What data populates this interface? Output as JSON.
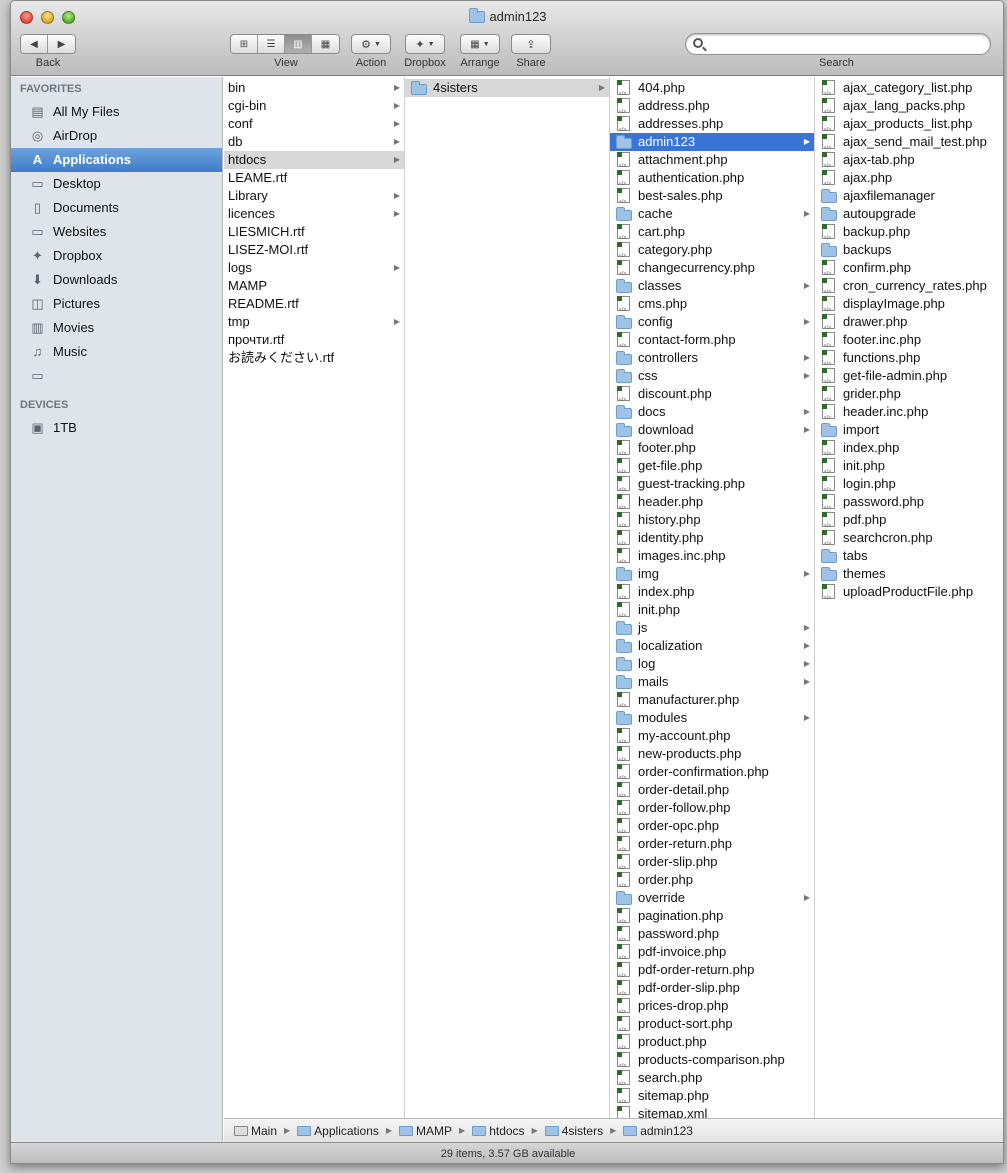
{
  "window": {
    "title": "admin123"
  },
  "toolbar": {
    "back_label": "Back",
    "view_label": "View",
    "action_label": "Action",
    "dropbox_label": "Dropbox",
    "arrange_label": "Arrange",
    "share_label": "Share",
    "search_label": "Search",
    "search_value": ""
  },
  "sidebar": {
    "favorites_heading": "FAVORITES",
    "devices_heading": "DEVICES",
    "favorites": [
      {
        "label": "All My Files",
        "icon": "all-files-icon",
        "glyph": "▤"
      },
      {
        "label": "AirDrop",
        "icon": "airdrop-icon",
        "glyph": "◎"
      },
      {
        "label": "Applications",
        "icon": "applications-icon",
        "glyph": "A"
      },
      {
        "label": "Desktop",
        "icon": "desktop-icon",
        "glyph": "▭"
      },
      {
        "label": "Documents",
        "icon": "documents-icon",
        "glyph": "▯"
      },
      {
        "label": "Websites",
        "icon": "websites-icon",
        "glyph": "▭"
      },
      {
        "label": "Dropbox",
        "icon": "dropbox-icon",
        "glyph": "✦"
      },
      {
        "label": "Downloads",
        "icon": "downloads-icon",
        "glyph": "⬇"
      },
      {
        "label": "Pictures",
        "icon": "pictures-icon",
        "glyph": "◫"
      },
      {
        "label": "Movies",
        "icon": "movies-icon",
        "glyph": "▥"
      },
      {
        "label": "Music",
        "icon": "music-icon",
        "glyph": "♫"
      }
    ],
    "selected_index": 2,
    "devices": [
      {
        "label": "1TB",
        "icon": "hard-disk-icon",
        "glyph": "▣"
      }
    ]
  },
  "columns": {
    "col1": [
      {
        "name": "bin",
        "folder": true
      },
      {
        "name": "cgi-bin",
        "folder": true
      },
      {
        "name": "conf",
        "folder": true
      },
      {
        "name": "db",
        "folder": true
      },
      {
        "name": "htdocs",
        "folder": true,
        "highlight": true
      },
      {
        "name": "LEAME.rtf",
        "folder": false
      },
      {
        "name": "Library",
        "folder": true
      },
      {
        "name": "licences",
        "folder": true
      },
      {
        "name": "LIESMICH.rtf",
        "folder": false
      },
      {
        "name": "LISEZ-MOI.rtf",
        "folder": false
      },
      {
        "name": "logs",
        "folder": true
      },
      {
        "name": "MAMP",
        "folder": false
      },
      {
        "name": "README.rtf",
        "folder": false
      },
      {
        "name": "tmp",
        "folder": true
      },
      {
        "name": "прочти.rtf",
        "folder": false
      },
      {
        "name": "お読みください.rtf",
        "folder": false
      }
    ],
    "col2": [
      {
        "name": "4sisters",
        "folder": true,
        "highlight": true
      }
    ],
    "col3": [
      {
        "name": "404.php",
        "folder": false
      },
      {
        "name": "address.php",
        "folder": false
      },
      {
        "name": "addresses.php",
        "folder": false
      },
      {
        "name": "admin123",
        "folder": true,
        "selected": true
      },
      {
        "name": "attachment.php",
        "folder": false
      },
      {
        "name": "authentication.php",
        "folder": false
      },
      {
        "name": "best-sales.php",
        "folder": false
      },
      {
        "name": "cache",
        "folder": true
      },
      {
        "name": "cart.php",
        "folder": false
      },
      {
        "name": "category.php",
        "folder": false
      },
      {
        "name": "changecurrency.php",
        "folder": false
      },
      {
        "name": "classes",
        "folder": true
      },
      {
        "name": "cms.php",
        "folder": false
      },
      {
        "name": "config",
        "folder": true
      },
      {
        "name": "contact-form.php",
        "folder": false
      },
      {
        "name": "controllers",
        "folder": true
      },
      {
        "name": "css",
        "folder": true
      },
      {
        "name": "discount.php",
        "folder": false
      },
      {
        "name": "docs",
        "folder": true
      },
      {
        "name": "download",
        "folder": true
      },
      {
        "name": "footer.php",
        "folder": false
      },
      {
        "name": "get-file.php",
        "folder": false
      },
      {
        "name": "guest-tracking.php",
        "folder": false
      },
      {
        "name": "header.php",
        "folder": false
      },
      {
        "name": "history.php",
        "folder": false
      },
      {
        "name": "identity.php",
        "folder": false
      },
      {
        "name": "images.inc.php",
        "folder": false
      },
      {
        "name": "img",
        "folder": true
      },
      {
        "name": "index.php",
        "folder": false
      },
      {
        "name": "init.php",
        "folder": false
      },
      {
        "name": "js",
        "folder": true
      },
      {
        "name": "localization",
        "folder": true
      },
      {
        "name": "log",
        "folder": true
      },
      {
        "name": "mails",
        "folder": true
      },
      {
        "name": "manufacturer.php",
        "folder": false
      },
      {
        "name": "modules",
        "folder": true
      },
      {
        "name": "my-account.php",
        "folder": false
      },
      {
        "name": "new-products.php",
        "folder": false
      },
      {
        "name": "order-confirmation.php",
        "folder": false
      },
      {
        "name": "order-detail.php",
        "folder": false
      },
      {
        "name": "order-follow.php",
        "folder": false
      },
      {
        "name": "order-opc.php",
        "folder": false
      },
      {
        "name": "order-return.php",
        "folder": false
      },
      {
        "name": "order-slip.php",
        "folder": false
      },
      {
        "name": "order.php",
        "folder": false
      },
      {
        "name": "override",
        "folder": true
      },
      {
        "name": "pagination.php",
        "folder": false
      },
      {
        "name": "password.php",
        "folder": false
      },
      {
        "name": "pdf-invoice.php",
        "folder": false
      },
      {
        "name": "pdf-order-return.php",
        "folder": false
      },
      {
        "name": "pdf-order-slip.php",
        "folder": false
      },
      {
        "name": "prices-drop.php",
        "folder": false
      },
      {
        "name": "product-sort.php",
        "folder": false
      },
      {
        "name": "product.php",
        "folder": false
      },
      {
        "name": "products-comparison.php",
        "folder": false
      },
      {
        "name": "search.php",
        "folder": false
      },
      {
        "name": "sitemap.php",
        "folder": false
      },
      {
        "name": "sitemap.xml",
        "folder": false
      }
    ],
    "col4": [
      {
        "name": "ajax_category_list.php",
        "folder": false
      },
      {
        "name": "ajax_lang_packs.php",
        "folder": false
      },
      {
        "name": "ajax_products_list.php",
        "folder": false
      },
      {
        "name": "ajax_send_mail_test.php",
        "folder": false
      },
      {
        "name": "ajax-tab.php",
        "folder": false
      },
      {
        "name": "ajax.php",
        "folder": false
      },
      {
        "name": "ajaxfilemanager",
        "folder": true,
        "noarrow": true
      },
      {
        "name": "autoupgrade",
        "folder": true,
        "noarrow": true
      },
      {
        "name": "backup.php",
        "folder": false
      },
      {
        "name": "backups",
        "folder": true,
        "noarrow": true
      },
      {
        "name": "confirm.php",
        "folder": false
      },
      {
        "name": "cron_currency_rates.php",
        "folder": false
      },
      {
        "name": "displayImage.php",
        "folder": false
      },
      {
        "name": "drawer.php",
        "folder": false
      },
      {
        "name": "footer.inc.php",
        "folder": false
      },
      {
        "name": "functions.php",
        "folder": false
      },
      {
        "name": "get-file-admin.php",
        "folder": false
      },
      {
        "name": "grider.php",
        "folder": false
      },
      {
        "name": "header.inc.php",
        "folder": false
      },
      {
        "name": "import",
        "folder": true,
        "noarrow": true
      },
      {
        "name": "index.php",
        "folder": false
      },
      {
        "name": "init.php",
        "folder": false
      },
      {
        "name": "login.php",
        "folder": false
      },
      {
        "name": "password.php",
        "folder": false
      },
      {
        "name": "pdf.php",
        "folder": false
      },
      {
        "name": "searchcron.php",
        "folder": false
      },
      {
        "name": "tabs",
        "folder": true,
        "noarrow": true
      },
      {
        "name": "themes",
        "folder": true,
        "noarrow": true
      },
      {
        "name": "uploadProductFile.php",
        "folder": false
      }
    ]
  },
  "pathbar": [
    "Main",
    "Applications",
    "MAMP",
    "htdocs",
    "4sisters",
    "admin123"
  ],
  "status": {
    "text": "29 items, 3.57 GB available"
  }
}
